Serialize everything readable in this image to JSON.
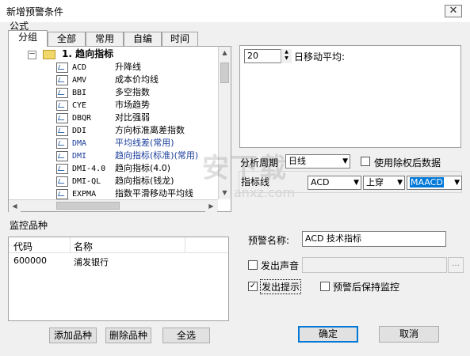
{
  "window": {
    "title": "新增预警条件",
    "close_label": "✕"
  },
  "formula_section": {
    "label": "公式"
  },
  "tabs": [
    {
      "label": "分组"
    },
    {
      "label": "全部"
    },
    {
      "label": "常用"
    },
    {
      "label": "自编"
    },
    {
      "label": "时间"
    }
  ],
  "tree": {
    "expander": "－",
    "group_label": "1. 趋向指标",
    "items": [
      {
        "code": "ACD",
        "name": "升降线"
      },
      {
        "code": "AMV",
        "name": "成本价均线"
      },
      {
        "code": "BBI",
        "name": "多空指数"
      },
      {
        "code": "CYE",
        "name": "市场趋势"
      },
      {
        "code": "DBQR",
        "name": "对比强弱"
      },
      {
        "code": "DDI",
        "name": "方向标准离差指数"
      },
      {
        "code": "DMA",
        "name": "平均线差(常用)"
      },
      {
        "code": "DMI",
        "name": "趋向指标(标准)(常用)"
      },
      {
        "code": "DMI-4.0",
        "name": "趋向指标(4.0)"
      },
      {
        "code": "DMI-QL",
        "name": "趋向指标(钱龙)"
      },
      {
        "code": "EXPMA",
        "name": "指数平滑移动平均线"
      }
    ]
  },
  "param": {
    "value": "20",
    "label": "日移动平均:"
  },
  "analysis": {
    "period_label": "分析周期",
    "period_value": "日线",
    "adjust_label": "使用除权后数据",
    "indicator_label": "指标线",
    "indicator_value": "ACD",
    "operator_value": "上穿",
    "target_value": "MAACD"
  },
  "monitor": {
    "label": "监控品种",
    "columns": [
      "代码",
      "名称"
    ],
    "rows": [
      {
        "code": "600000",
        "name": "浦发银行"
      }
    ],
    "add_button": "添加品种",
    "delete_button": "删除品种",
    "select_all_button": "全选"
  },
  "alert": {
    "name_label": "预警名称:",
    "name_value": "ACD 技术指标",
    "sound_label": "发出声音",
    "browse_label": "...",
    "prompt_label": "发出提示",
    "prompt_checked": true,
    "keep_label": "预警后保持监控"
  },
  "footer": {
    "ok_button": "确定",
    "cancel_button": "取消"
  },
  "watermark": {
    "text1": "安下载",
    "text2": "anxz.com"
  }
}
